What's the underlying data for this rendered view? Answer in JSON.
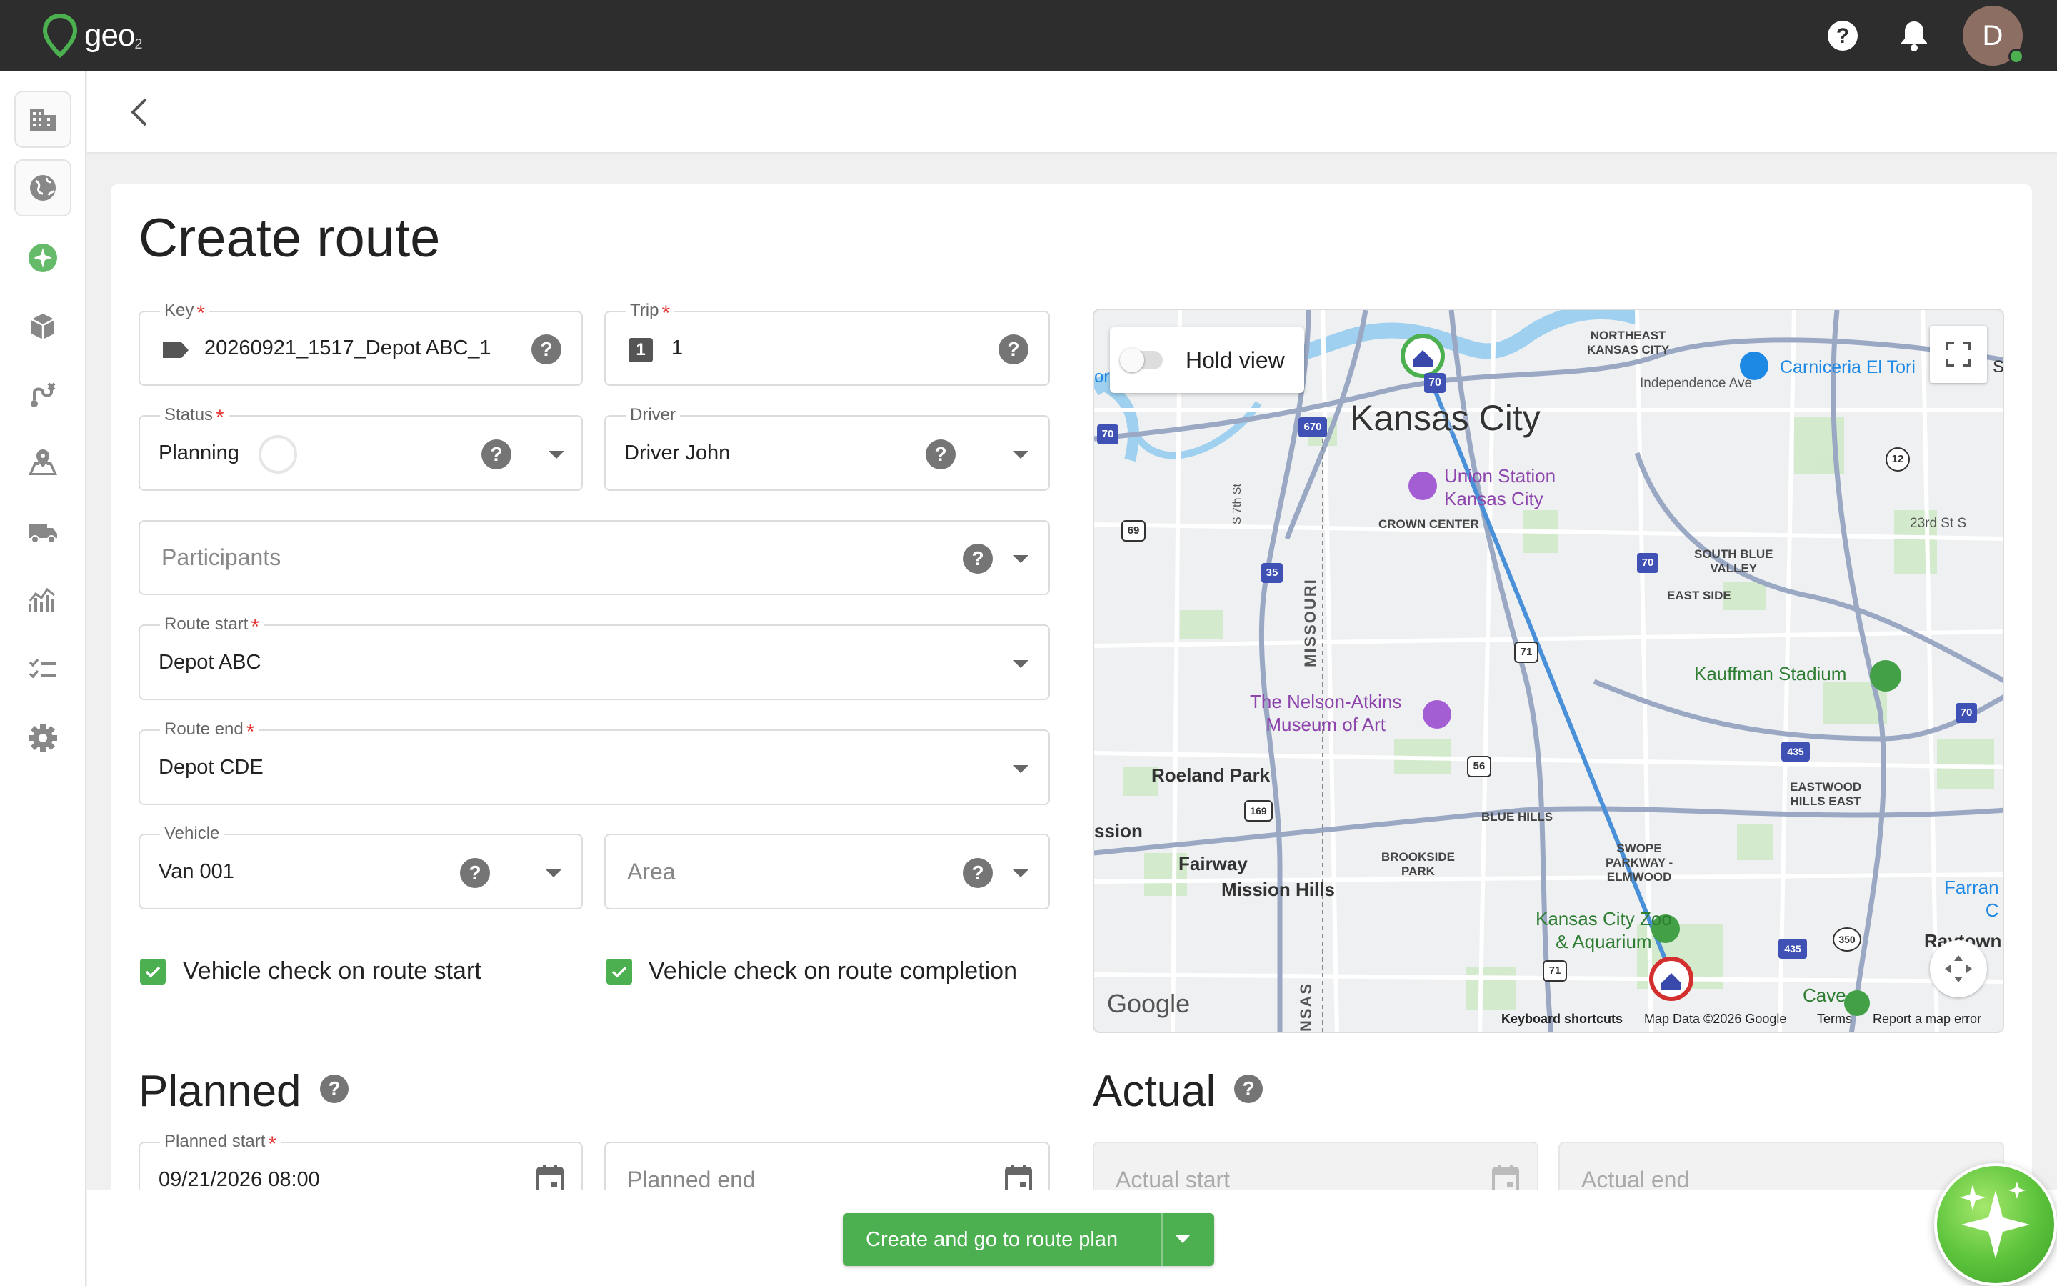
{
  "app": {
    "logo_text": "geo",
    "logo_sub": "2",
    "avatar_initial": "D"
  },
  "page": {
    "title": "Create route"
  },
  "form": {
    "key": {
      "label": "Key",
      "value": "20260921_1517_Depot ABC_1"
    },
    "trip": {
      "label": "Trip",
      "value": "1",
      "badge": "1"
    },
    "status": {
      "label": "Status",
      "value": "Planning"
    },
    "driver": {
      "label": "Driver",
      "value": "Driver John"
    },
    "participants": {
      "placeholder": "Participants"
    },
    "route_start": {
      "label": "Route start",
      "value": "Depot ABC"
    },
    "route_end": {
      "label": "Route end",
      "value": "Depot CDE"
    },
    "vehicle": {
      "label": "Vehicle",
      "value": "Van 001"
    },
    "area": {
      "placeholder": "Area"
    },
    "check_start": {
      "label": "Vehicle check on route start",
      "checked": true
    },
    "check_completion": {
      "label": "Vehicle check on route completion",
      "checked": true
    }
  },
  "planned": {
    "title": "Planned",
    "start": {
      "label": "Planned start",
      "value": "09/21/2026 08:00"
    },
    "end": {
      "placeholder": "Planned end"
    }
  },
  "actual": {
    "title": "Actual",
    "start": {
      "placeholder": "Actual start"
    },
    "end": {
      "placeholder": "Actual end"
    }
  },
  "map": {
    "hold_view": "Hold view",
    "labels": {
      "city": "Kansas City",
      "northeast": "NORTHEAST\nKANSAS CITY",
      "carniceria": "Carniceria El Tori",
      "independence": "Independence Ave",
      "union_station": "Union Station\nKansas City",
      "crown_center": "CROWN CENTER",
      "south_blue_valley": "SOUTH BLUE\nVALLEY",
      "east_side": "EAST SIDE",
      "kauffman": "Kauffman Stadium",
      "nelson": "The Nelson-Atkins\nMuseum of Art",
      "roeland": "Roeland Park",
      "mission": "ssion",
      "blue_hills": "BLUE HILLS",
      "eastwood": "EASTWOOD\nHILLS EAST",
      "fairway": "Fairway",
      "mission_hills": "Mission Hills",
      "brookside": "BROOKSIDE\nPARK",
      "swope": "SWOPE\nPARKWAY -\nELMWOOD",
      "zoo": "Kansas City Zoo\n& Aquarium",
      "farran": "Farran\nC",
      "raytown": "Raytown",
      "cave": "Cave",
      "missouri": "MISSOURI",
      "kansas": "NSAS",
      "s7th": "S 7th St",
      "twentythird": "23rd St S",
      "ori": "ori",
      "s": "S"
    },
    "shields": {
      "i70a": "70",
      "i670": "670",
      "i70b": "70",
      "us69": "69",
      "i35": "35",
      "m12": "12",
      "i70c": "70",
      "us71a": "71",
      "i70d": "70",
      "i435a": "435",
      "us56": "56",
      "k169": "169",
      "i435b": "435",
      "m350": "350",
      "us71b": "71"
    },
    "footer": {
      "google": "Google",
      "shortcuts": "Keyboard shortcuts",
      "data": "Map Data ©2026 Google",
      "terms": "Terms",
      "report": "Report a map error"
    }
  },
  "actions": {
    "create": "Create and go to route plan"
  },
  "colors": {
    "accent": "#4caf50",
    "topbar": "#2d2d2d",
    "required": "#e53935",
    "route_line": "#4a90d9"
  }
}
